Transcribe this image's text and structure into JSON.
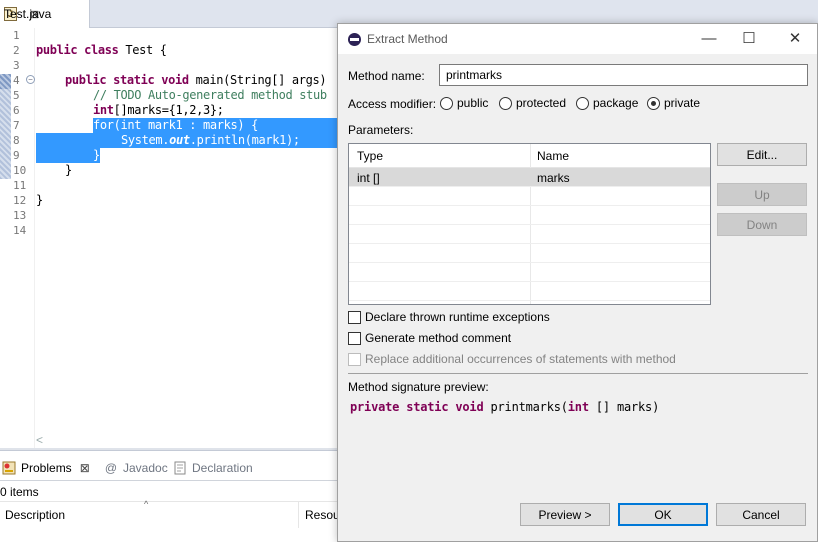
{
  "editor": {
    "tab_icon": "J",
    "tab_label": "Test.java",
    "tab_close": "⊠",
    "line_numbers": [
      "1",
      "2",
      "3",
      "4",
      "5",
      "6",
      "7",
      "8",
      "9",
      "10",
      "11",
      "12",
      "13",
      "14"
    ],
    "fold_glyph": "−",
    "scroll_left": "<",
    "code": {
      "l2_kw": "public class",
      "l2_rest": " Test {",
      "l4_kw": "public static void",
      "l4_rest": " main(String[] args)",
      "l5_comment": "// TODO Auto-generated method stub",
      "l6_kw": "int",
      "l6_rest": "[]marks={1,2,3};",
      "l7": "for(int mark1 : marks) {",
      "l8_a": "System.",
      "l8_b": "out",
      "l8_c": ".println(mark1);",
      "l9": "}",
      "l10": "}",
      "l12": "}"
    }
  },
  "views": {
    "tabs": [
      {
        "label": "Problems",
        "icon": "problems-icon",
        "close": "⊠"
      },
      {
        "label": "Javadoc",
        "icon": "at-icon",
        "glyph": "@"
      },
      {
        "label": "Declaration",
        "icon": "declaration-icon"
      }
    ],
    "items_count": "0 items",
    "columns": [
      "Description",
      "Resou"
    ],
    "sort_glyph": "^"
  },
  "dialog": {
    "title": "Extract Method",
    "window_controls": {
      "minimize": "—",
      "maximize": "☐",
      "close": "✕"
    },
    "method_name_label": "Method name:",
    "method_name_value": "printmarks",
    "access_label": "Access modifier:",
    "access_options": [
      "public",
      "protected",
      "package",
      "private"
    ],
    "access_selected": "private",
    "parameters_label": "Parameters:",
    "param_columns": [
      "Type",
      "Name"
    ],
    "params": [
      {
        "type": "int []",
        "name": "marks"
      }
    ],
    "buttons": {
      "edit": "Edit...",
      "up": "Up",
      "down": "Down",
      "preview": "Preview >",
      "ok": "OK",
      "cancel": "Cancel"
    },
    "checkboxes": {
      "runtime_exceptions": "Declare thrown runtime exceptions",
      "method_comment": "Generate method comment",
      "replace_occurrences": "Replace additional occurrences of statements with method"
    },
    "signature_label": "Method signature preview:",
    "signature": {
      "kw": "private static void",
      "mid": " printmarks(",
      "kw2": "int",
      "end": " [] marks)"
    }
  }
}
